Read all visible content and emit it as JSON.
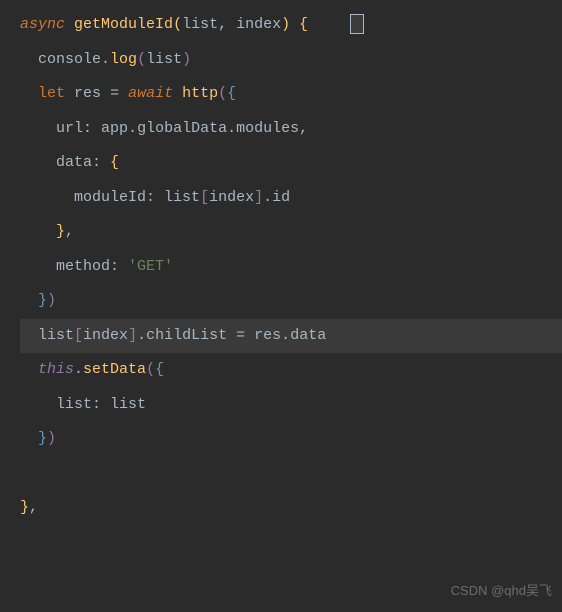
{
  "code": {
    "l1_async": "async",
    "l1_func": "getModuleId",
    "l1_p1": "list",
    "l1_p2": "index",
    "l2_console": "console",
    "l2_log": "log",
    "l2_arg": "list",
    "l3_let": "let",
    "l3_res": "res",
    "l3_eq": "=",
    "l3_await": "await",
    "l3_http": "http",
    "l4_url": "url",
    "l4_app": "app",
    "l4_globalData": "globalData",
    "l4_modules": "modules",
    "l5_data": "data",
    "l6_moduleId": "moduleId",
    "l6_list": "list",
    "l6_index": "index",
    "l6_id": "id",
    "l8_method": "method",
    "l8_get": "'GET'",
    "l10_list": "list",
    "l10_index": "index",
    "l10_childList": "childList",
    "l10_eq": "=",
    "l10_res": "res",
    "l10_data": "data",
    "l11_this": "this",
    "l11_setData": "setData",
    "l12_listkey": "list",
    "l12_listval": "list"
  },
  "watermark": "CSDN @qhd吴飞"
}
